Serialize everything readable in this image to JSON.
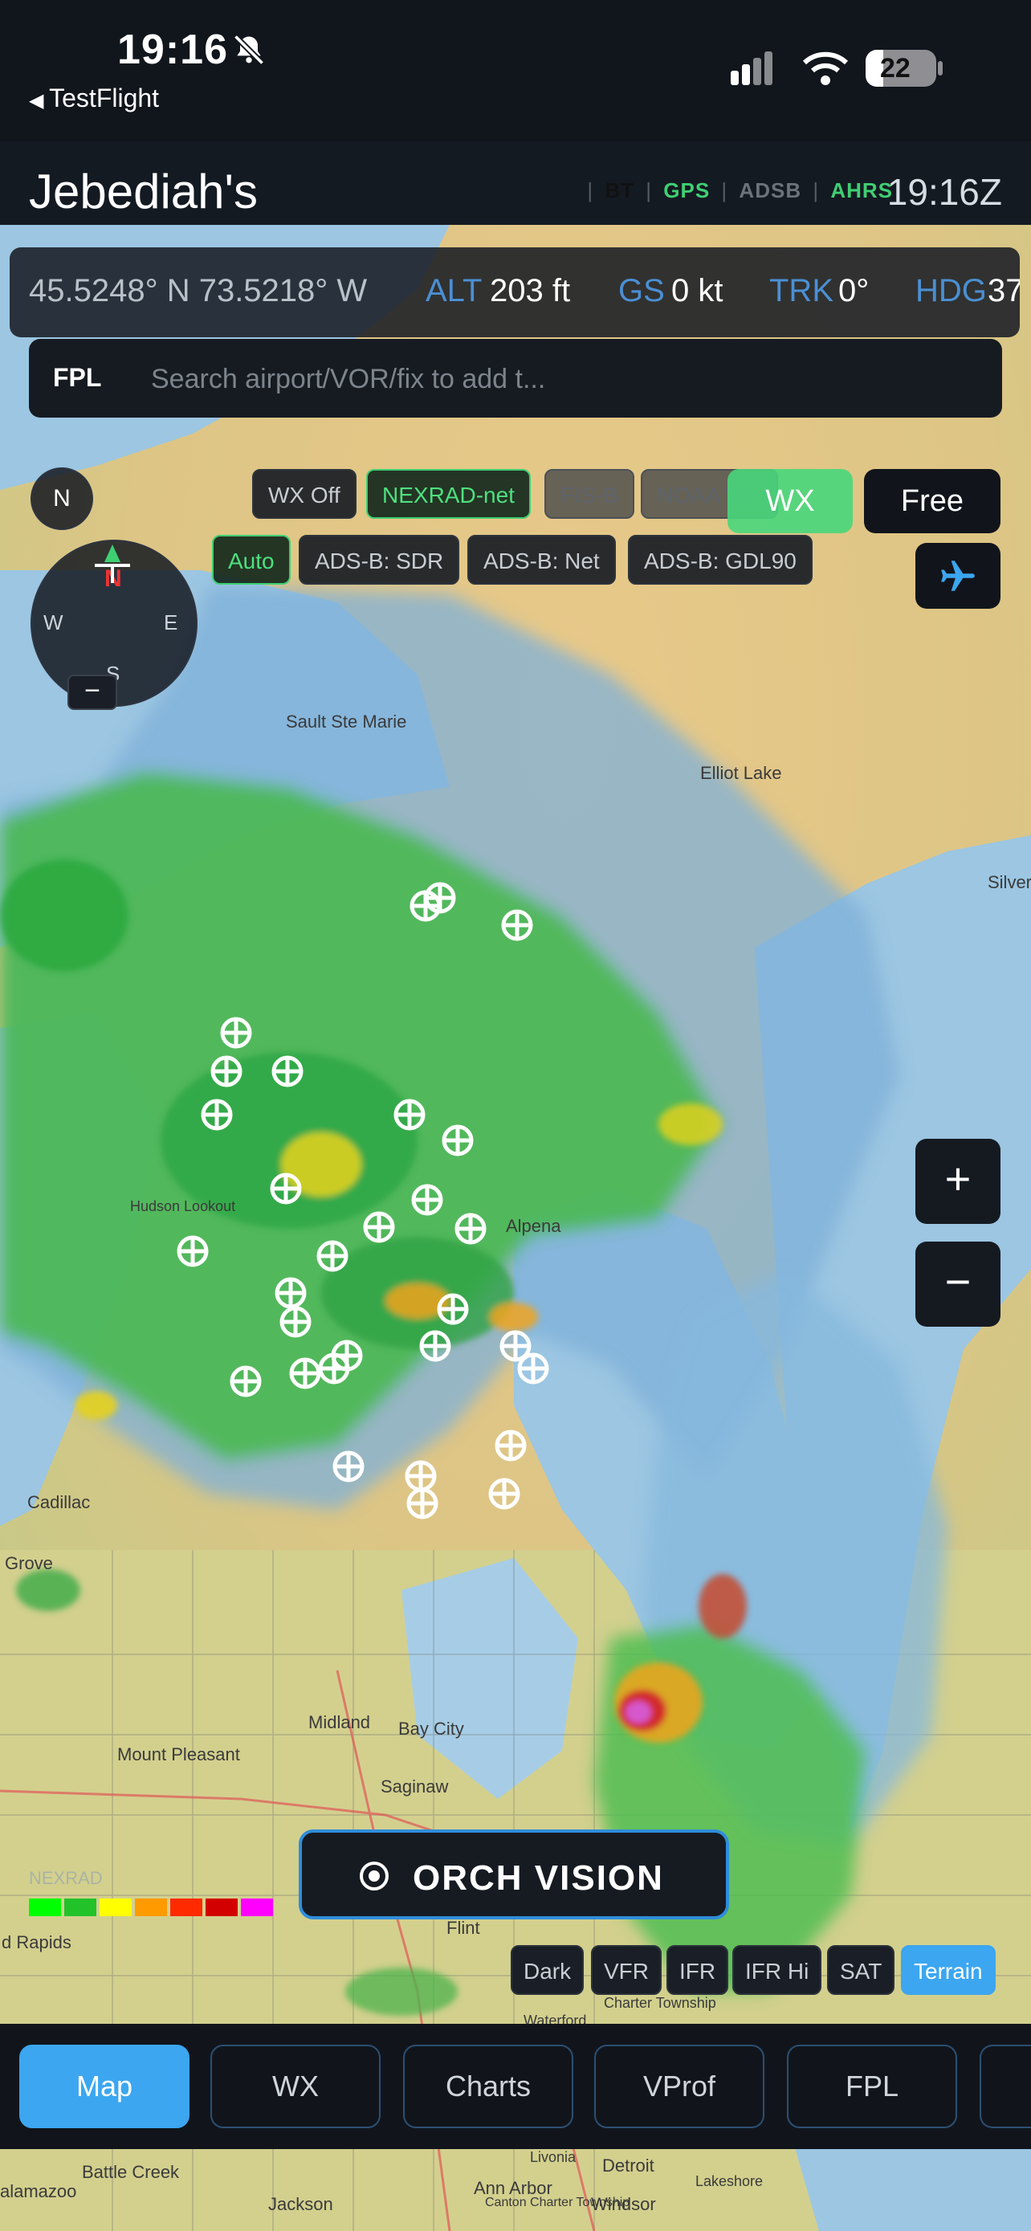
{
  "status_bar": {
    "time": "19:16",
    "back_app": "TestFlight",
    "battery": "22"
  },
  "header": {
    "title": "Jebediah's",
    "indicators": [
      {
        "label": "BT",
        "color": "#111111"
      },
      {
        "label": "GPS",
        "color": "#3fcf73"
      },
      {
        "label": "ADSB",
        "color": "#6b7279"
      },
      {
        "label": "AHRS",
        "color": "#3fcf73"
      }
    ],
    "zulu_time": "19:16Z"
  },
  "telemetry": {
    "coords": "45.5248° N  73.5218° W",
    "alt_label": "ALT",
    "alt_value": "203 ft",
    "gs_label": "GS",
    "gs_value": "0 kt",
    "trk_label": "TRK",
    "trk_value": "0°",
    "hdg_label": "HDG",
    "hdg_value": "37"
  },
  "fpl": {
    "label": "FPL",
    "placeholder": "Search airport/VOR/fix to add t..."
  },
  "weather_sources": {
    "wx_off": "WX Off",
    "nexrad_net": "NEXRAD-net",
    "fis_b": "FIS-B",
    "noaa_wx": "NOAA WX"
  },
  "traffic_sources": {
    "auto": "Auto",
    "sdr": "ADS-B: SDR",
    "net": "ADS-B: Net",
    "gdl90": "ADS-B: GDL90"
  },
  "map_controls": {
    "wx": "WX",
    "free": "Free",
    "zoom_in": "+",
    "zoom_out": "−"
  },
  "compass": {
    "n_button": "N",
    "north": "N",
    "west": "W",
    "east": "E",
    "south": "S",
    "minimize": "−"
  },
  "orch": {
    "label": "ORCH VISION"
  },
  "legend": {
    "label": "NEXRAD",
    "colors": [
      "#00ff00",
      "#22c32a",
      "#ffff00",
      "#ff9a00",
      "#ff2a00",
      "#d20000",
      "#ff00ff"
    ]
  },
  "map_layers": [
    "Dark",
    "VFR",
    "IFR",
    "IFR Hi",
    "SAT",
    "Terrain"
  ],
  "active_layer": "Terrain",
  "map_labels": {
    "sault": "Sault Ste Marie",
    "elliot": "Elliot Lake",
    "silver": "Silver",
    "alpena": "Alpena",
    "hudson": "Hudson Lookout",
    "cadillac": "Cadillac",
    "grove": "Grove",
    "mount_pleasant": "Mount Pleasant",
    "midland": "Midland",
    "bay_city": "Bay City",
    "saginaw": "Saginaw",
    "rapids": "d Rapids",
    "flint": "Flint",
    "charter": "Charter Township",
    "waterford": "Waterford",
    "battle_creek": "Battle Creek",
    "jackson": "Jackson",
    "ann_arbor": "Ann Arbor",
    "detroit": "Detroit",
    "windsor": "Windsor",
    "lakeshore": "Lakeshore",
    "canton": "Canton Charter Township",
    "livonia": "Livonia",
    "alamazoo": "alamazoo"
  },
  "tabs": [
    "Map",
    "WX",
    "Charts",
    "VProf",
    "FPL"
  ],
  "active_tab": "Map"
}
